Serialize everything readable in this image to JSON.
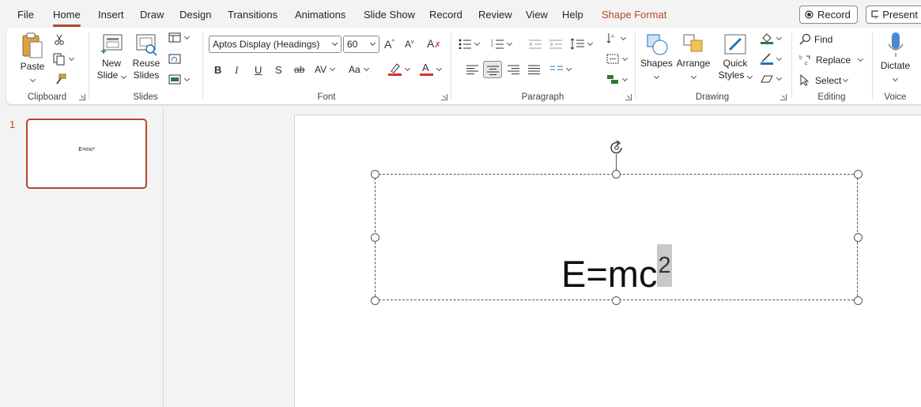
{
  "menu": {
    "tabs": [
      "File",
      "Home",
      "Insert",
      "Draw",
      "Design",
      "Transitions",
      "Animations",
      "Slide Show",
      "Record",
      "Review",
      "View",
      "Help",
      "Shape Format"
    ],
    "active_tab": "Home",
    "record_btn": "Record",
    "present_btn": "Present"
  },
  "ribbon": {
    "clipboard": {
      "label": "Clipboard",
      "paste": "Paste"
    },
    "slides": {
      "label": "Slides",
      "new_slide_1": "New",
      "new_slide_2": "Slide",
      "reuse_1": "Reuse",
      "reuse_2": "Slides"
    },
    "font": {
      "label": "Font",
      "font_name": "Aptos Display (Headings)",
      "font_size": "60"
    },
    "paragraph": {
      "label": "Paragraph"
    },
    "drawing": {
      "label": "Drawing",
      "shapes": "Shapes",
      "arrange": "Arrange",
      "quick_1": "Quick",
      "quick_2": "Styles"
    },
    "editing": {
      "label": "Editing",
      "find": "Find",
      "replace": "Replace",
      "select": "Select"
    },
    "voice": {
      "label": "Voice",
      "dictate": "Dictate"
    }
  },
  "thumbnails": {
    "number": "1",
    "text": "E=mc²"
  },
  "slide": {
    "formula_base": "E=mc",
    "formula_sup": "2"
  },
  "colors": {
    "accent": "#b7472a",
    "font_color_bar": "#d13438",
    "highlight_bar": "#d13438"
  }
}
